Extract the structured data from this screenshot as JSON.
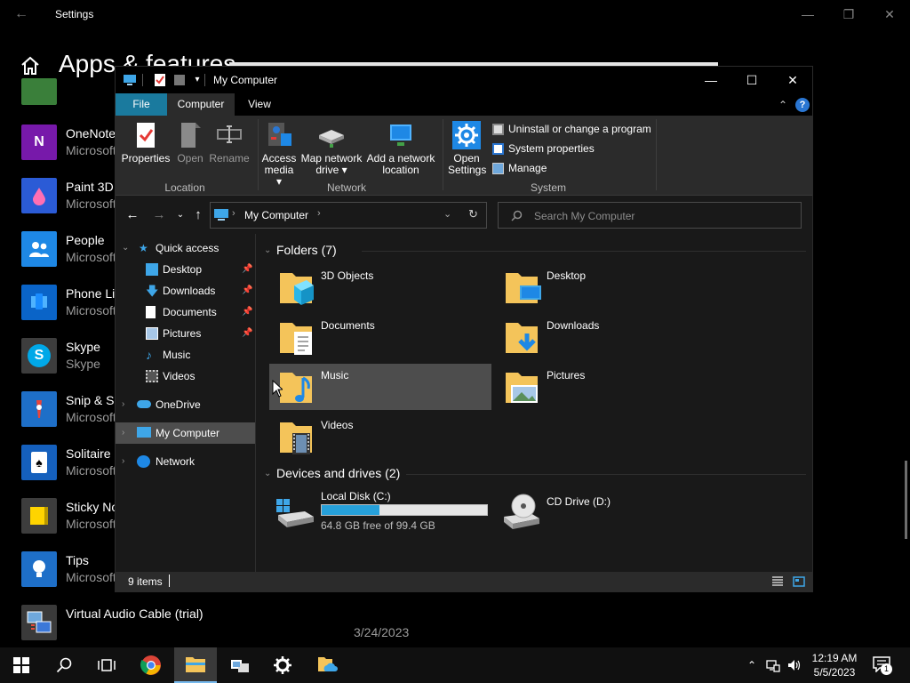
{
  "settings": {
    "title": "Settings",
    "heading": "Apps & features",
    "apps": [
      {
        "name": "",
        "publisher": ""
      },
      {
        "name": "OneNote",
        "publisher": "Microsoft"
      },
      {
        "name": "Paint 3D",
        "publisher": "Microsoft"
      },
      {
        "name": "People",
        "publisher": "Microsoft"
      },
      {
        "name": "Phone Link",
        "publisher": "Microsoft"
      },
      {
        "name": "Skype",
        "publisher": "Skype"
      },
      {
        "name": "Snip & Sketch",
        "publisher": "Microsoft"
      },
      {
        "name": "Solitaire Collection",
        "publisher": "Microsoft"
      },
      {
        "name": "Sticky Notes",
        "publisher": "Microsoft"
      },
      {
        "name": "Tips",
        "publisher": "Microsoft"
      },
      {
        "name": "Virtual Audio Cable (trial)",
        "publisher": ""
      }
    ],
    "last_date": "3/24/2023"
  },
  "explorer": {
    "title": "My Computer",
    "tabs": {
      "file": "File",
      "computer": "Computer",
      "view": "View"
    },
    "ribbon": {
      "properties": "Properties",
      "open": "Open",
      "rename": "Rename",
      "access_media": "Access media ▾",
      "map_drive": "Map network drive ▾",
      "add_location": "Add a network location",
      "open_settings": "Open Settings",
      "uninstall": "Uninstall or change a program",
      "system_properties": "System properties",
      "manage": "Manage",
      "group_location": "Location",
      "group_network": "Network",
      "group_system": "System"
    },
    "address": "My Computer",
    "search_placeholder": "Search My Computer",
    "nav": {
      "quick_access": "Quick access",
      "desktop": "Desktop",
      "downloads": "Downloads",
      "documents": "Documents",
      "pictures": "Pictures",
      "music": "Music",
      "videos": "Videos",
      "onedrive": "OneDrive",
      "my_computer": "My Computer",
      "network": "Network"
    },
    "folders_header": "Folders (7)",
    "folders": [
      "3D Objects",
      "Desktop",
      "Documents",
      "Downloads",
      "Music",
      "Pictures",
      "Videos"
    ],
    "drives_header": "Devices and drives (2)",
    "drives": [
      {
        "name": "Local Disk (C:)",
        "free": "64.8 GB free of 99.4 GB",
        "used_fraction": 0.348
      },
      {
        "name": "CD Drive (D:)"
      }
    ],
    "status": "9 items"
  },
  "taskbar": {
    "time": "12:19 AM",
    "date": "5/5/2023",
    "notification_count": "1"
  },
  "colors": {
    "accent": "#1a7a9e",
    "drive_fill": "#26a0da",
    "folder": "#f4c45a"
  }
}
